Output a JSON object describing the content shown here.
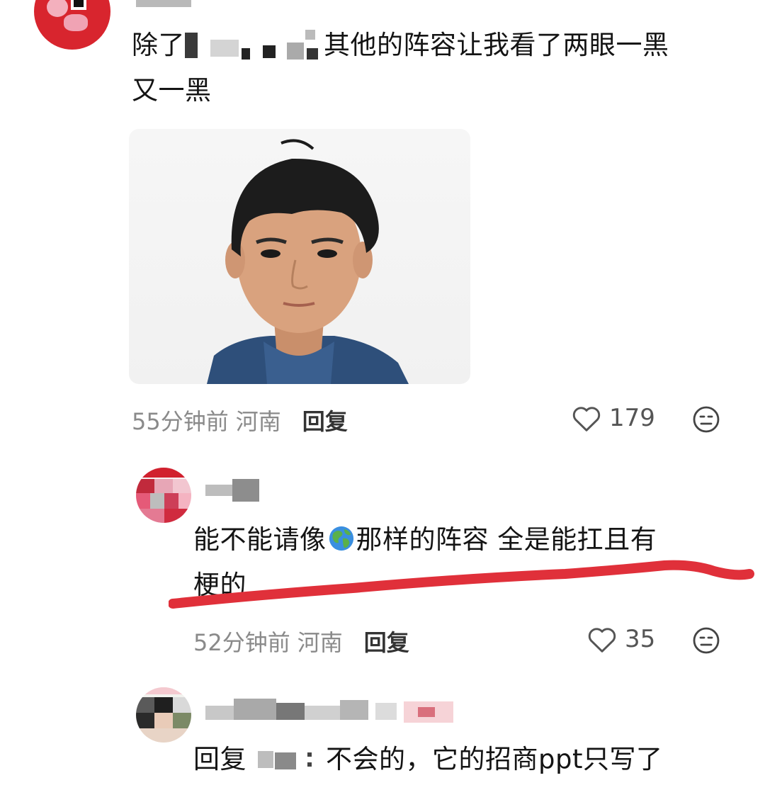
{
  "comments": [
    {
      "text_line1_before": "除了",
      "text_line1_after": "其他的阵容让我看了两眼一黑",
      "text_line2": "又一黑",
      "time": "55分钟前",
      "location": "河南",
      "reply_label": "回复",
      "likes": "179"
    },
    {
      "text_before_emoji": "能不能请像",
      "text_after_emoji": "那样的阵容 全是能扛且有",
      "text_line2": "梗的",
      "time": "52分钟前",
      "location": "河南",
      "reply_label": "回复",
      "likes": "35",
      "annotation_color": "#e0303a"
    },
    {
      "reply_prefix": "回复",
      "text": "不会的，它的招商ppt只写了"
    }
  ],
  "icons": {
    "like": "heart-outline-icon",
    "emoji": "neutral-face-icon",
    "globe": "globe-africa-europe-emoji"
  },
  "colors": {
    "meta_text": "#8a8a8a",
    "reply_text": "#333333",
    "annotation": "#e0303a"
  }
}
